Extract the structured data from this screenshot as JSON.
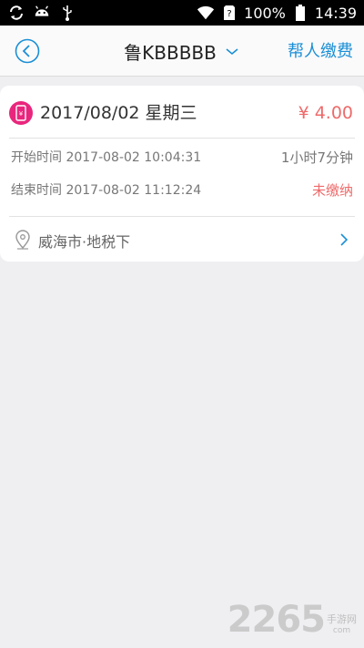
{
  "status_bar": {
    "battery": "100%",
    "time": "14:39",
    "icons": [
      "sync-icon",
      "android-icon",
      "usb-icon",
      "wifi-icon",
      "sim-unknown-icon",
      "battery-icon"
    ]
  },
  "header": {
    "title": "鲁KBBBBB",
    "help_pay_label": "帮人缴费",
    "accent_color": "#1a8fd6"
  },
  "record": {
    "date": "2017/08/02 星期三",
    "amount": "¥ 4.00",
    "start_label": "开始时间",
    "start_time": "2017-08-02 10:04:31",
    "duration": "1小时7分钟",
    "end_label": "结束时间",
    "end_time": "2017-08-02 11:12:24",
    "status": "未缴纳",
    "location": "威海市·地税下",
    "amount_color": "#ee6a6a",
    "badge_color": "#e9267d"
  },
  "watermark": {
    "number": "2265",
    "text_cn": "手游网",
    "text_en": "com"
  }
}
